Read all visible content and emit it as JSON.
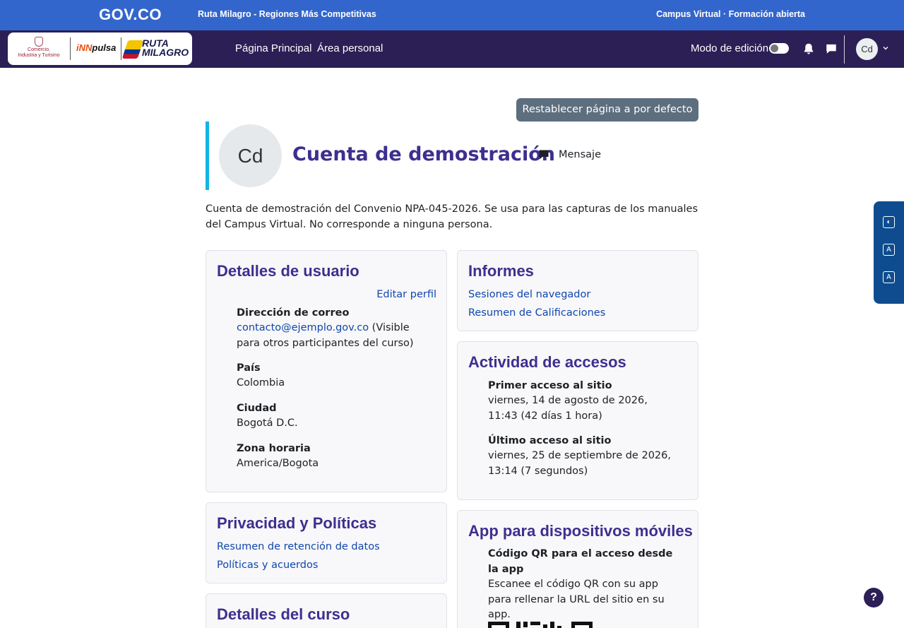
{
  "govbar": {
    "logo": "GOV.CO",
    "tagline": "Ruta Milagro - Regiones Más Competitivas",
    "right_text": "Campus Virtual · Formación abierta"
  },
  "navbar": {
    "logos": {
      "mincomercio_line1": "Comercio,",
      "mincomercio_line2": "Industria y Turismo",
      "innpulsa_inn": "iNN",
      "innpulsa_rest": "pulsa",
      "ruta_line1": "RUTA",
      "ruta_line2": "MILAGRO"
    },
    "links": [
      {
        "label": "Página Principal"
      },
      {
        "label": "Área personal"
      }
    ],
    "edit_mode_label": "Modo de edición",
    "edit_mode_on": false,
    "user_initials": "Cd"
  },
  "page": {
    "reset_button": "Restablecer página a por defecto",
    "profile": {
      "initials": "Cd",
      "name": "Cuenta de demostración",
      "message_label": "Mensaje"
    },
    "description": "Cuenta de demostración del Convenio NPA-045-2026. Se usa para las capturas de los manuales del Campus Virtual. No corresponde a ninguna persona."
  },
  "user_details": {
    "title": "Detalles de usuario",
    "edit_link": "Editar perfil",
    "email_label": "Dirección de correo",
    "email_value": "contacto@ejemplo.gov.co",
    "email_visibility": " (Visible para otros participantes del curso)",
    "country_label": "País",
    "country_value": "Colombia",
    "city_label": "Ciudad",
    "city_value": "Bogotá D.C.",
    "timezone_label": "Zona horaria",
    "timezone_value": "America/Bogota"
  },
  "reports": {
    "title": "Informes",
    "links": [
      "Sesiones del navegador",
      "Resumen de Calificaciones"
    ]
  },
  "access_activity": {
    "title": "Actividad de accesos",
    "first_label": "Primer acceso al sitio",
    "first_value_line1": "viernes, 14 de agosto de 2026,",
    "first_value_line2": "11:43  (42 días 1 hora)",
    "last_label": "Último acceso al sitio",
    "last_value_line1": "viernes, 25 de septiembre de 2026,",
    "last_value_line2": "13:14  (7 segundos)"
  },
  "privacy": {
    "title": "Privacidad y Políticas",
    "links": [
      "Resumen de retención de datos",
      "Políticas y acuerdos"
    ]
  },
  "mobile_app": {
    "title": "App para dispositivos móviles",
    "qr_label_line1": "Código QR para el acceso desde",
    "qr_label_line2": "la app",
    "qr_desc_line1": "Escanee el código QR con su app",
    "qr_desc_line2": "para rellenar la URL del sitio en su",
    "qr_desc_line3": "app."
  },
  "course_details": {
    "title": "Detalles del curso"
  },
  "help_button": "?"
}
